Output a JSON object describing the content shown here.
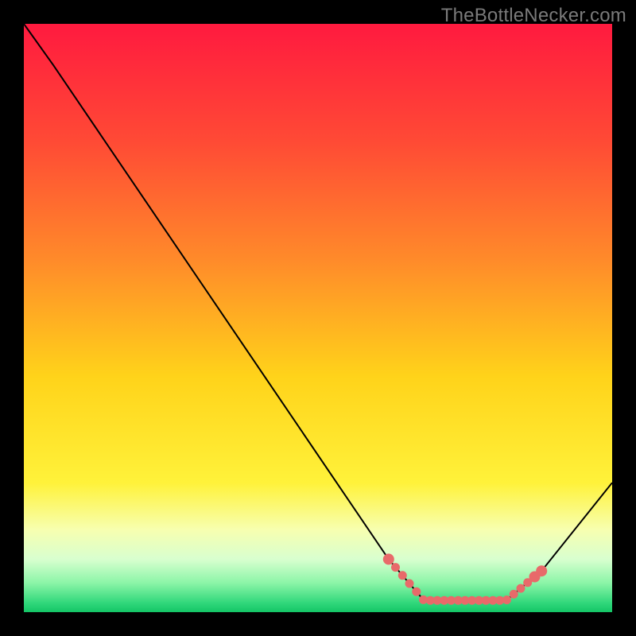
{
  "attribution": "TheBottleNecker.com",
  "chart_data": {
    "type": "line",
    "title": "",
    "xlabel": "",
    "ylabel": "",
    "xlim": [
      0,
      100
    ],
    "ylim": [
      0,
      100
    ],
    "x": [
      0,
      5,
      62,
      68,
      82,
      88,
      100
    ],
    "values": [
      100,
      93,
      9,
      2,
      2,
      7,
      22
    ],
    "marker_band": {
      "x_start": 62,
      "x_end": 88,
      "y_min": 2,
      "y_max": 9
    },
    "gradient_stops": [
      {
        "offset": 0.0,
        "color": "#ff1a3f"
      },
      {
        "offset": 0.2,
        "color": "#ff4a35"
      },
      {
        "offset": 0.4,
        "color": "#ff8a2a"
      },
      {
        "offset": 0.6,
        "color": "#ffd31a"
      },
      {
        "offset": 0.78,
        "color": "#fff23a"
      },
      {
        "offset": 0.86,
        "color": "#f7ffb0"
      },
      {
        "offset": 0.91,
        "color": "#d8ffcf"
      },
      {
        "offset": 0.95,
        "color": "#8cf5a8"
      },
      {
        "offset": 0.985,
        "color": "#2fd77a"
      },
      {
        "offset": 1.0,
        "color": "#14c566"
      }
    ],
    "curve_color": "#000000",
    "marker_color": "#e86a6a"
  }
}
